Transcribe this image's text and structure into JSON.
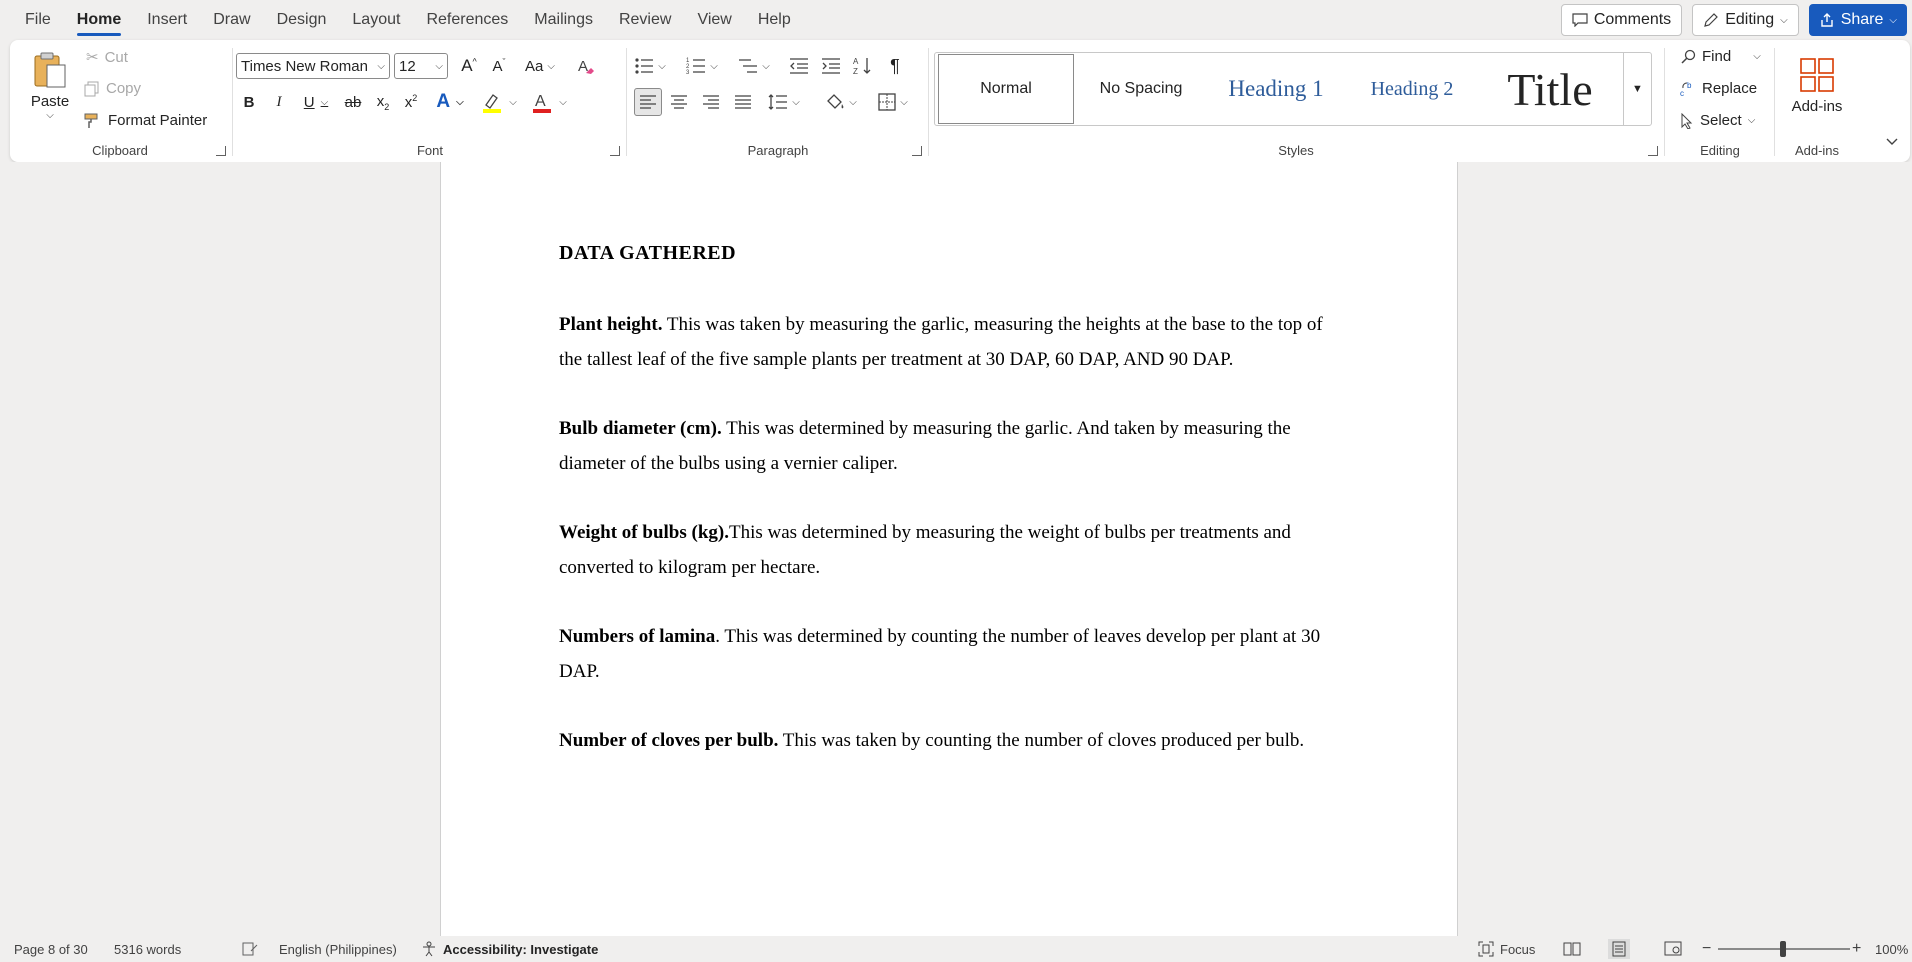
{
  "menu": {
    "tabs": [
      "File",
      "Home",
      "Insert",
      "Draw",
      "Design",
      "Layout",
      "References",
      "Mailings",
      "Review",
      "View",
      "Help"
    ],
    "active": "Home",
    "comments_label": "Comments",
    "editing_label": "Editing",
    "share_label": "Share"
  },
  "ribbon": {
    "clipboard": {
      "paste_label": "Paste",
      "cut_label": "Cut",
      "copy_label": "Copy",
      "format_painter_label": "Format Painter",
      "group_label": "Clipboard"
    },
    "font": {
      "font_name": "Times New Roman",
      "font_size": "12",
      "group_label": "Font",
      "highlight_color": "#ffff00",
      "font_color": "#e02020"
    },
    "paragraph": {
      "group_label": "Paragraph"
    },
    "styles": {
      "items": [
        "Normal",
        "No Spacing",
        "Heading 1",
        "Heading 2",
        "Title"
      ],
      "group_label": "Styles",
      "heading_color": "#2e5c9a"
    },
    "editing": {
      "find_label": "Find",
      "replace_label": "Replace",
      "select_label": "Select",
      "group_label": "Editing"
    },
    "addins": {
      "addins_label": "Add-ins",
      "group_label": "Add-ins"
    }
  },
  "document": {
    "heading": "DATA GATHERED",
    "paragraphs": [
      {
        "bold": "Plant height.",
        "text": " This was taken by measuring the garlic, measuring the heights at the base to the top of the tallest leaf of the five sample plants per treatment at 30 DAP, 60 DAP, AND 90 DAP."
      },
      {
        "bold": "Bulb diameter (cm).",
        "text": " This was determined by measuring the garlic. And taken by measuring the diameter of the bulbs using a vernier caliper."
      },
      {
        "bold": "Weight of bulbs (kg).",
        "text": "This was determined by measuring the weight of bulbs per treatments and converted to kilogram per hectare."
      },
      {
        "bold": "Numbers of lamina",
        "text": ". This was determined by counting the number of leaves develop per plant at 30 DAP."
      },
      {
        "bold": "Number of cloves per bulb.",
        "text": " This was taken by counting the number of cloves produced per bulb."
      }
    ]
  },
  "status": {
    "page": "Page 8 of 30",
    "words": "5316 words",
    "language": "English (Philippines)",
    "accessibility": "Accessibility: Investigate",
    "focus": "Focus",
    "zoom": "100%"
  },
  "colors": {
    "accent": "#185abd"
  }
}
